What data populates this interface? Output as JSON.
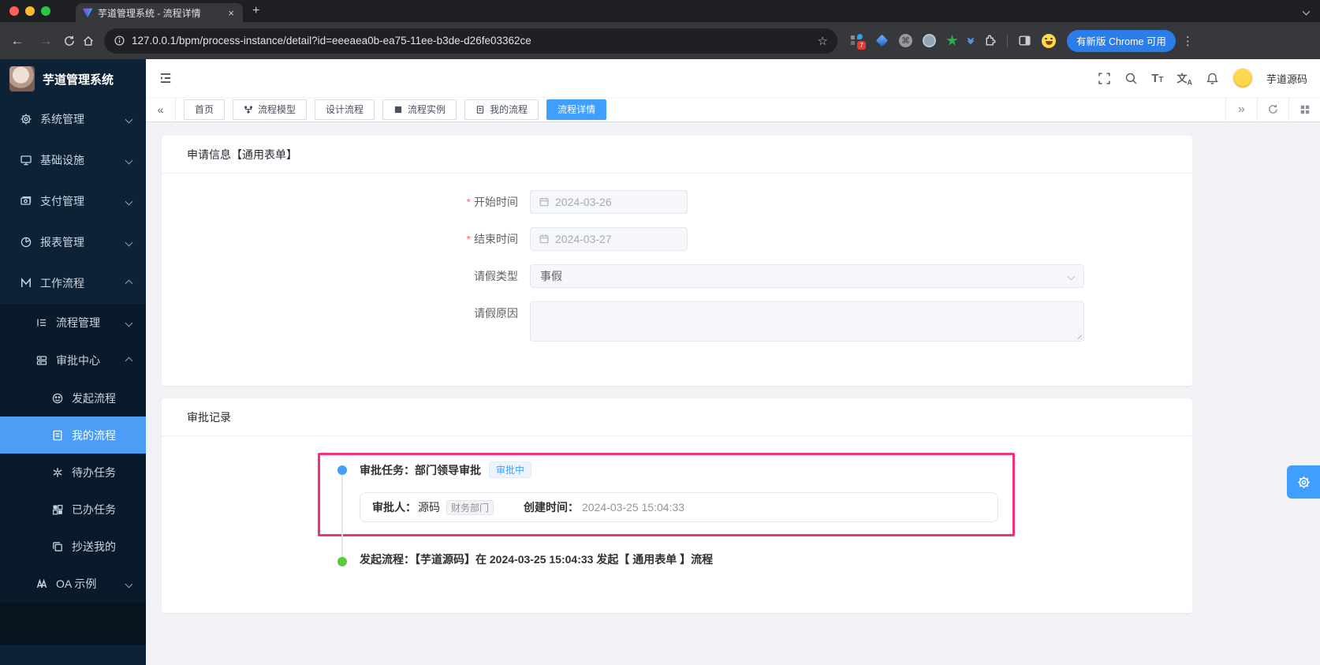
{
  "colors": {
    "accent": "#409eff",
    "annotation_pink": "#f5317f",
    "timeline_green": "#5ac93c",
    "sidebar_bg": "#0d2236"
  },
  "browser": {
    "tab_title": "芋道管理系统 - 流程详情",
    "url": "127.0.0.1/bpm/process-instance/detail?id=eeeaea0b-ea75-11ee-b3de-d26fe03362ce",
    "update_button": "有新版 Chrome 可用",
    "extension_badge": "7"
  },
  "app_header": {
    "logo_title": "芋道管理系统",
    "username": "芋道源码"
  },
  "sidebar": {
    "items": [
      {
        "label": "系统管理",
        "icon": "gear"
      },
      {
        "label": "基础设施",
        "icon": "monitor"
      },
      {
        "label": "支付管理",
        "icon": "wallet"
      },
      {
        "label": "报表管理",
        "icon": "pie-chart"
      },
      {
        "label": "工作流程",
        "icon": "workflow"
      },
      {
        "label": "流程管理",
        "icon": "list"
      },
      {
        "label": "审批中心",
        "icon": "approval-rows"
      },
      {
        "label": "发起流程",
        "icon": "smiley"
      },
      {
        "label": "我的流程",
        "icon": "document"
      },
      {
        "label": "待办任务",
        "icon": "pinwheel"
      },
      {
        "label": "已办任务",
        "icon": "quadrant"
      },
      {
        "label": "抄送我的",
        "icon": "copy"
      },
      {
        "label": "OA 示例",
        "icon": "binoculars"
      }
    ]
  },
  "nav_tabs": {
    "items": [
      {
        "label": "首页"
      },
      {
        "label": "流程模型",
        "icon": "flow"
      },
      {
        "label": "设计流程"
      },
      {
        "label": "流程实例",
        "icon": "square"
      },
      {
        "label": "我的流程",
        "icon": "document"
      },
      {
        "label": "流程详情",
        "active": true
      }
    ]
  },
  "form": {
    "title": "申请信息【通用表单】",
    "start_label": "开始时间",
    "start_value": "2024-03-26",
    "end_label": "结束时间",
    "end_value": "2024-03-27",
    "type_label": "请假类型",
    "type_value": "事假",
    "reason_label": "请假原因",
    "reason_value": ""
  },
  "record": {
    "title": "审批记录",
    "task_title": "审批任务：部门领导审批",
    "task_status": "审批中",
    "approver_label": "审批人：",
    "approver_name": "源码",
    "approver_dept": "财务部门",
    "created_label": "创建时间：",
    "created_time": "2024-03-25 15:04:33",
    "start_event": "发起流程：【芋道源码】在 2024-03-25 15:04:33 发起【 通用表单 】流程"
  }
}
